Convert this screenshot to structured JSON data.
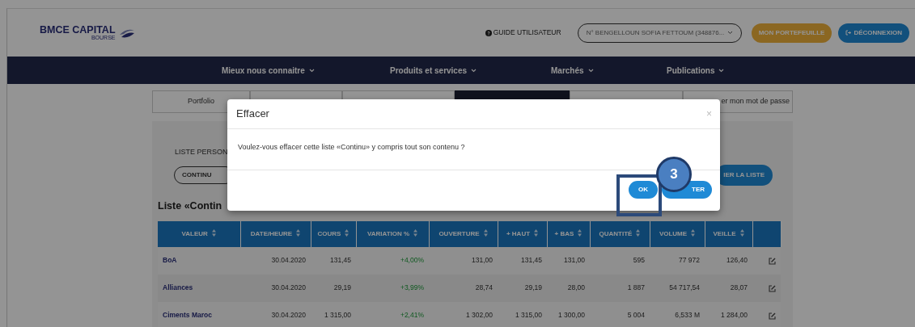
{
  "header": {
    "logo": {
      "name": "BMCE CAPITAL",
      "sub": "BOURSE"
    },
    "guide_link": "GUIDE UTILISATEUR",
    "account_select": "N° BENGELLOUN SOFIA FETTOUM (348876...",
    "buttons": [
      {
        "kind": "portfolio",
        "label": "MON PORTEFEUILLE"
      },
      {
        "kind": "logout",
        "label": "DÉCONNEXION"
      }
    ]
  },
  "nav": [
    "Mieux nous connaitre",
    "Produits et services",
    "Marchés",
    "Publications"
  ],
  "tabs": [
    {
      "label": "Portfolio",
      "selected": false
    },
    {
      "selected": false
    },
    {
      "selected": false
    },
    {
      "selected": true
    },
    {
      "selected": false
    },
    {
      "label": "er mon mot de passe",
      "selected": false
    }
  ],
  "list_panel": {
    "label": "LISTE PERSON",
    "select_value": "CONTINU",
    "action_button": "IER LA LISTE",
    "title": "Liste «Contin"
  },
  "table": {
    "columns": [
      "VALEUR",
      "DATE/HEURE",
      "COURS",
      "VARIATION %",
      "OUVERTURE",
      "+ HAUT",
      "+ BAS",
      "QUANTITÉ",
      "VOLUME",
      "VEILLE"
    ],
    "rows": [
      [
        "BoA",
        "30.04.2020",
        "131,45",
        "+4,00%",
        "131,00",
        "131,45",
        "131,00",
        "595",
        "77 972",
        "126,40"
      ],
      [
        "Alliances",
        "30.04.2020",
        "29,19",
        "+3,99%",
        "28,74",
        "29,19",
        "28,00",
        "1 887",
        "54 717,54",
        "28,07"
      ],
      [
        "Ciments Maroc",
        "30.04.2020",
        "1 315,00",
        "+2,41%",
        "1 302,00",
        "1 315,00",
        "1 300,00",
        "5 004",
        "6,533 M",
        "1 284,00"
      ]
    ]
  },
  "modal": {
    "title": "Effacer",
    "close": "×",
    "message": "Voulez-vous effacer cette liste «Continu» y compris tout son contenu ?",
    "buttons": [
      {
        "kind": "ok",
        "label": "OK"
      },
      {
        "kind": "cancel",
        "label": "TER"
      }
    ]
  },
  "annotation": {
    "step": "3"
  }
}
